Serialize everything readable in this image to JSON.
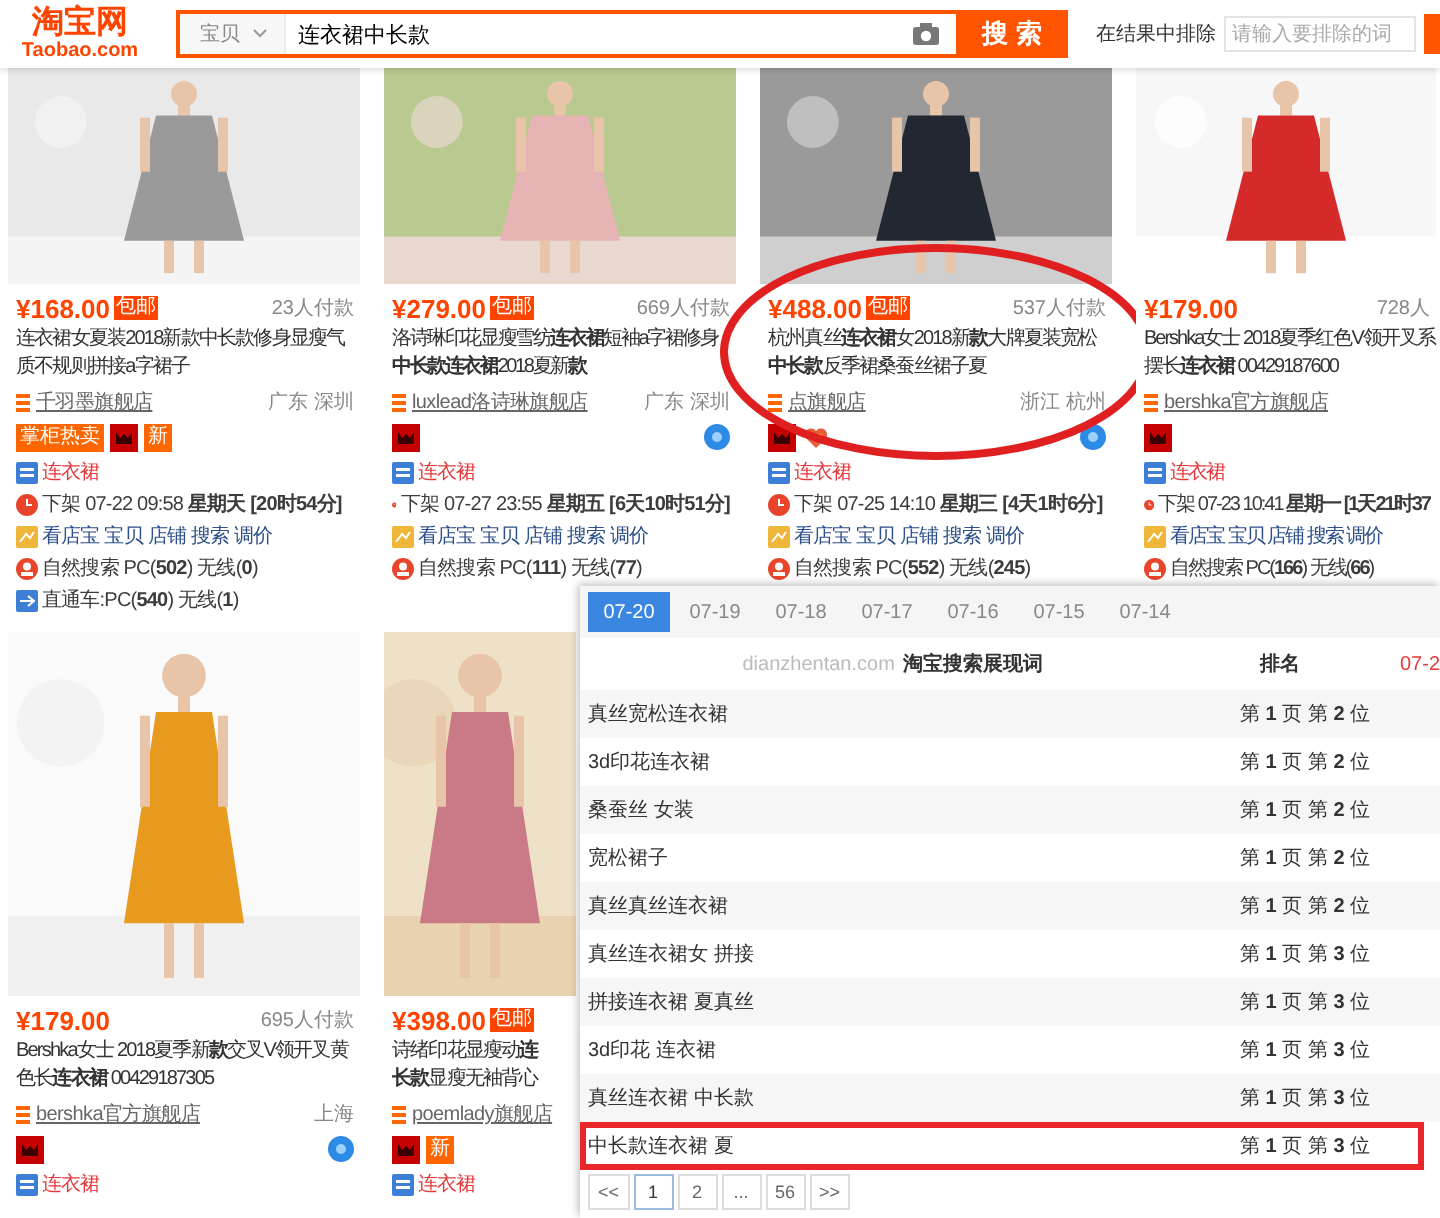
{
  "header": {
    "logo": "淘宝网",
    "logo_sub": "Taobao.com",
    "search": {
      "category": "宝贝",
      "value": "连衣裙中长款",
      "button": "搜 索"
    },
    "exclude": {
      "label": "在结果中排除",
      "placeholder": "请输入要排除的词"
    }
  },
  "product_rows": [
    {
      "products": [
        {
          "price": "¥168.00",
          "shipping": "包邮",
          "sales": "23人付款",
          "title_lines": [
            "连衣裙女夏装2018新款中长款修身显瘦气",
            "质不规则拼接a字裙子"
          ],
          "shop": "千羽墨旗舰店",
          "location": "广东 深圳",
          "badges": [
            {
              "kind": "label",
              "text": "掌柜热卖"
            },
            {
              "kind": "tmall"
            },
            {
              "kind": "label",
              "text": "新"
            }
          ],
          "chat": false,
          "circled": false,
          "info": [
            {
              "kind": "category",
              "text": "连衣裙"
            },
            {
              "kind": "delist",
              "text": "下架 07-22 09:58 **星期天 [20时54分]**"
            },
            {
              "kind": "tools",
              "text": "看店宝 宝贝 店铺 搜索 调价"
            },
            {
              "kind": "natural",
              "text": "自然搜索 PC(**502**) 无线(**0**)"
            },
            {
              "kind": "ztc",
              "text": "直通车:PC(**540**) 无线(**1**)"
            }
          ]
        },
        {
          "price": "¥279.00",
          "shipping": "包邮",
          "sales": "669人付款",
          "title_lines": [
            "洛诗琳印花显瘦雪纺**连衣裙**短袖a字裙修身",
            "**中长款连衣裙**2018夏新**款**"
          ],
          "shop": "luxlead洛诗琳旗舰店",
          "location": "广东 深圳",
          "badges": [
            {
              "kind": "tmall"
            }
          ],
          "chat": true,
          "circled": false,
          "info": [
            {
              "kind": "category",
              "text": "连衣裙"
            },
            {
              "kind": "delist",
              "text": "下架 07-27 23:55 **星期五 [6天10时51分]**"
            },
            {
              "kind": "tools",
              "text": "看店宝 宝贝 店铺 搜索 调价"
            },
            {
              "kind": "natural",
              "text": "自然搜索 PC(**111**) 无线(**77**)"
            }
          ]
        },
        {
          "price": "¥488.00",
          "shipping": "包邮",
          "sales": "537人付款",
          "title_lines": [
            "杭州真丝**连衣裙**女2018新**款**大牌夏装宽松",
            "**中长款**反季裙桑蚕丝裙子夏"
          ],
          "shop": "点旗舰店",
          "location": "浙江 杭州",
          "badges": [
            {
              "kind": "tmall"
            },
            {
              "kind": "heart"
            }
          ],
          "chat": true,
          "circled": true,
          "info": [
            {
              "kind": "category",
              "text": "连衣裙"
            },
            {
              "kind": "delist",
              "text": "下架 07-25 14:10 **星期三 [4天1时6分]**"
            },
            {
              "kind": "tools",
              "text": "看店宝 宝贝 店铺 搜索 调价"
            },
            {
              "kind": "natural",
              "text": "自然搜索 PC(**552**) 无线(**245**)"
            }
          ]
        },
        {
          "price": "¥179.00",
          "sales": "728人",
          "title_lines": [
            "Bershka女士 2018夏季红色V领开叉系",
            "摆长**连衣裙** 00429187600"
          ],
          "shop": "bershka官方旗舰店",
          "badges": [
            {
              "kind": "tmall"
            }
          ],
          "chat": false,
          "circled": false,
          "info": [
            {
              "kind": "category",
              "text": "连衣裙"
            },
            {
              "kind": "delist",
              "text": "下架 07-23 10:41 **星期一 [1天21时37**"
            },
            {
              "kind": "tools",
              "text": "看店宝 宝贝 店铺 搜索 调价"
            },
            {
              "kind": "natural",
              "text": "自然搜索 PC(**166**) 无线(**66**)"
            }
          ]
        }
      ]
    },
    {
      "products": [
        {
          "price": "¥179.00",
          "sales": "695人付款",
          "title_lines": [
            "Bershka女士 2018夏季新**款**交叉V领开叉黄",
            "色长**连衣裙** 00429187305"
          ],
          "shop": "bershka官方旗舰店",
          "location": "上海",
          "badges": [
            {
              "kind": "tmall"
            }
          ],
          "chat": true,
          "circled": false,
          "info": [
            {
              "kind": "category",
              "text": "连衣裙"
            }
          ]
        },
        {
          "price": "¥398.00",
          "shipping": "包邮",
          "title_lines": [
            "诗绪印花显瘦动**连**",
            "**长款**显瘦无袖背心"
          ],
          "shop": "poemlady旗舰店",
          "badges": [
            {
              "kind": "tmall"
            },
            {
              "kind": "label",
              "text": "新"
            }
          ],
          "chat": false,
          "circled": false,
          "info": [
            {
              "kind": "category",
              "text": "连衣裙"
            }
          ]
        }
      ]
    }
  ],
  "keyword_panel": {
    "tabs": [
      {
        "label": "07-20",
        "selected": true
      },
      {
        "label": "07-19",
        "selected": false
      },
      {
        "label": "07-18",
        "selected": false
      },
      {
        "label": "07-17",
        "selected": false
      },
      {
        "label": "07-16",
        "selected": false
      },
      {
        "label": "07-15",
        "selected": false
      },
      {
        "label": "07-14",
        "selected": false
      }
    ],
    "source": "dianzhentan.com",
    "title": "**淘宝搜索**展现词",
    "rank_header": "排名",
    "date_header": "07-2",
    "rows": [
      {
        "keyword": "真丝宽松连衣裙",
        "rank": "第 **1** 页 第 **2** 位",
        "highlighted": false
      },
      {
        "keyword": "3d印花连衣裙",
        "rank": "第 **1** 页 第 **2** 位",
        "highlighted": false
      },
      {
        "keyword": "桑蚕丝 女装",
        "rank": "第 **1** 页 第 **2** 位",
        "highlighted": false
      },
      {
        "keyword": "宽松裙子",
        "rank": "第 **1** 页 第 **2** 位",
        "highlighted": false
      },
      {
        "keyword": "真丝真丝连衣裙",
        "rank": "第 **1** 页 第 **2** 位",
        "highlighted": false
      },
      {
        "keyword": "真丝连衣裙女 拼接",
        "rank": "第 **1** 页 第 **3** 位",
        "highlighted": false
      },
      {
        "keyword": "拼接连衣裙 夏真丝",
        "rank": "第 **1** 页 第 **3** 位",
        "highlighted": false
      },
      {
        "keyword": "3d印花 连衣裙",
        "rank": "第 **1** 页 第 **3** 位",
        "highlighted": false
      },
      {
        "keyword": "真丝连衣裙 中长款",
        "rank": "第 **1** 页 第 **3** 位",
        "highlighted": false
      },
      {
        "keyword": "中长款连衣裙 夏",
        "rank": "第 **1** 页 第 **3** 位",
        "highlighted": true
      }
    ],
    "pagination": [
      {
        "label": "<<",
        "selected": false
      },
      {
        "label": "1",
        "selected": true
      },
      {
        "label": "2",
        "selected": false
      },
      {
        "label": "...",
        "selected": false
      },
      {
        "label": "56",
        "selected": false
      },
      {
        "label": ">>",
        "selected": false
      }
    ]
  }
}
